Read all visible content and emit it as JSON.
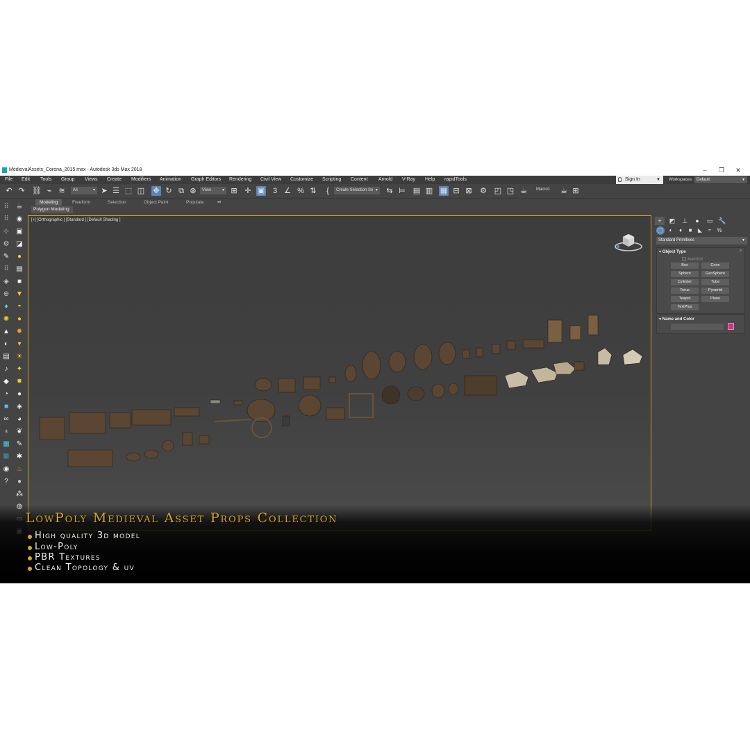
{
  "window": {
    "title": "MedievalAssets_Corona_2015.max - Autodesk 3ds Max 2018",
    "controls": [
      "–",
      "❐",
      "✕"
    ]
  },
  "menu": {
    "items": [
      "File",
      "Edit",
      "Tools",
      "Group",
      "Views",
      "Create",
      "Modifiers",
      "Animation",
      "Graph Editors",
      "Rendering",
      "Civil View",
      "Customize",
      "Scripting",
      "Content",
      "Arnold",
      "V-Ray",
      "Help",
      "rapidTools"
    ],
    "sign_in": "Sign In",
    "workspaces_label": "Workspaces:",
    "workspace_value": "Default"
  },
  "toolbar": {
    "selection_filter": "All",
    "ref_coord": "View",
    "named_selection": "Create Selection Se",
    "macro_label": "Macro1",
    "percent_icon": "%"
  },
  "ribbon": {
    "tabs": [
      "Modeling",
      "Freeform",
      "Selection",
      "Object Paint",
      "Populate"
    ],
    "sub_tab": "Polygon Modeling"
  },
  "viewport": {
    "label": "[+] [Orthographic ] [Standard ] [Default Shading ]"
  },
  "command_panel": {
    "category": "Standard Primitives",
    "object_type_title": "Object Type",
    "autogrid_label": "AutoGrid",
    "buttons": [
      "Box",
      "Cone",
      "Sphere",
      "GeoSphere",
      "Cylinder",
      "Tube",
      "Torus",
      "Pyramid",
      "Teapot",
      "Plane",
      "TextPlus"
    ],
    "name_color_title": "Name and Color",
    "object_color": "#e7238e"
  },
  "overlay": {
    "title": "LowPoly Medieval Asset Props Collection",
    "features": [
      "High quality 3d model",
      "Low-Poly",
      "PBR Textures",
      "Clean Topology & uv"
    ],
    "accent_color": "#d9a623"
  }
}
